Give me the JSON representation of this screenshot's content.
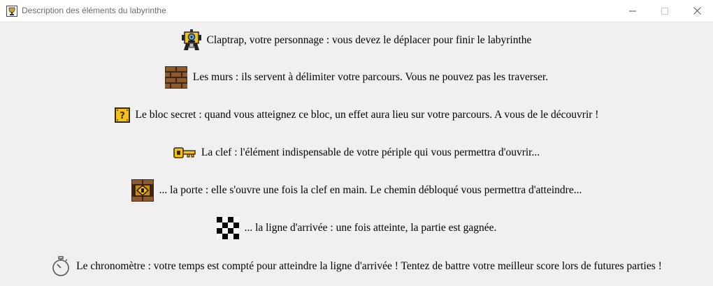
{
  "window": {
    "title": "Description des éléments du labyrinthe",
    "icons": {
      "app": "trophy-icon",
      "minimize": "minimize-icon",
      "maximize": "maximize-icon",
      "close": "close-icon"
    }
  },
  "items": [
    {
      "icon": "claptrap-icon",
      "text": "Claptrap, votre personnage : vous devez le déplacer pour finir le labyrinthe"
    },
    {
      "icon": "wall-icon",
      "text": "Les murs : ils servent à délimiter votre parcours. Vous ne pouvez pas les traverser."
    },
    {
      "icon": "secret-block-icon",
      "text": "Le bloc secret : quand vous atteignez ce bloc, un effet aura lieu sur votre parcours. A vous de le découvrir !"
    },
    {
      "icon": "key-icon",
      "text": "La clef : l'élément indispensable de votre périple qui vous permettra d'ouvrir..."
    },
    {
      "icon": "door-icon",
      "text": "... la porte : elle s'ouvre une fois la clef en main. Le chemin débloqué vous permettra d'atteindre..."
    },
    {
      "icon": "finish-line-icon",
      "text": "... la ligne d'arrivée : une fois atteinte, la partie est gagnée."
    },
    {
      "icon": "stopwatch-icon",
      "text": "Le chronomètre : votre temps est compté pour atteindre la ligne d'arrivée ! Tentez de battre votre meilleur score lors de futures parties !"
    }
  ],
  "colors": {
    "titlebar_bg": "#ffffff",
    "window_bg": "#f0f0f0",
    "title_text": "#6d6d6d"
  }
}
